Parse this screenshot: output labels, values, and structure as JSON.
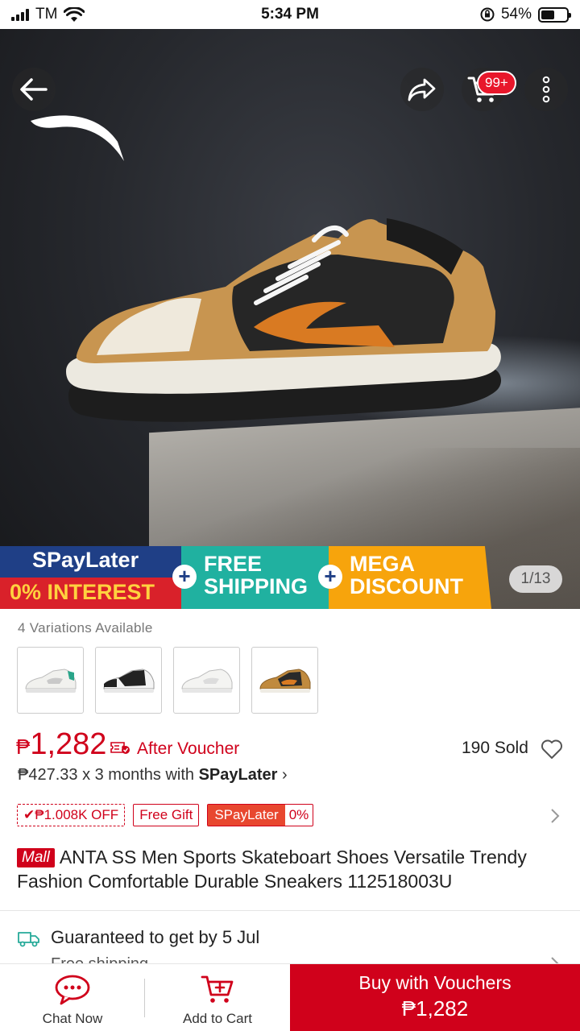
{
  "status_bar": {
    "carrier": "TM",
    "time": "5:34 PM",
    "battery": "54%",
    "battery_level": 0.54
  },
  "hero": {
    "cart_badge": "99+",
    "image_counter": "1/13",
    "promo": {
      "spaylater": "SPayLater",
      "interest": "0% INTEREST",
      "free_shipping_1": "FREE",
      "free_shipping_2": "SHIPPING",
      "mega_1": "MEGA",
      "mega_2": "DISCOUNT"
    }
  },
  "variations": {
    "label": "4 Variations Available",
    "items": [
      {
        "name": "white-green",
        "accent": "#2aa58a"
      },
      {
        "name": "black-white",
        "accent": "#222222"
      },
      {
        "name": "all-white",
        "accent": "#d9d9d9"
      },
      {
        "name": "brown-black",
        "accent": "#c08a3e"
      }
    ]
  },
  "price": {
    "currency": "₱",
    "amount": "1,282",
    "after_voucher": "After Voucher",
    "sold": "190 Sold",
    "installment_prefix": "₱427.33 x 3 months with ",
    "installment_brand": "SPayLater",
    "installment_chevron": "›"
  },
  "tags": {
    "off": "✔₱1.008K OFF",
    "gift": "Free Gift",
    "pay_a": "SPayLater",
    "pay_b": "0%"
  },
  "product": {
    "mall_badge": "Mall",
    "title": "ANTA SS Men Sports Skateboart Shoes Versatile Trendy Fashion Comfortable Durable Sneakers 112518003U"
  },
  "shipping": {
    "guarantee": "Guaranteed to get by 5 Jul",
    "sub": "Free shipping"
  },
  "bottom_bar": {
    "chat": "Chat Now",
    "add_to_cart": "Add to Cart",
    "buy_label": "Buy with Vouchers",
    "buy_price": "₱1,282"
  },
  "colors": {
    "brand_red": "#d0011b",
    "promo_blue": "#1f3f86",
    "promo_teal": "#20b1a0",
    "promo_orange": "#f7a40c"
  }
}
